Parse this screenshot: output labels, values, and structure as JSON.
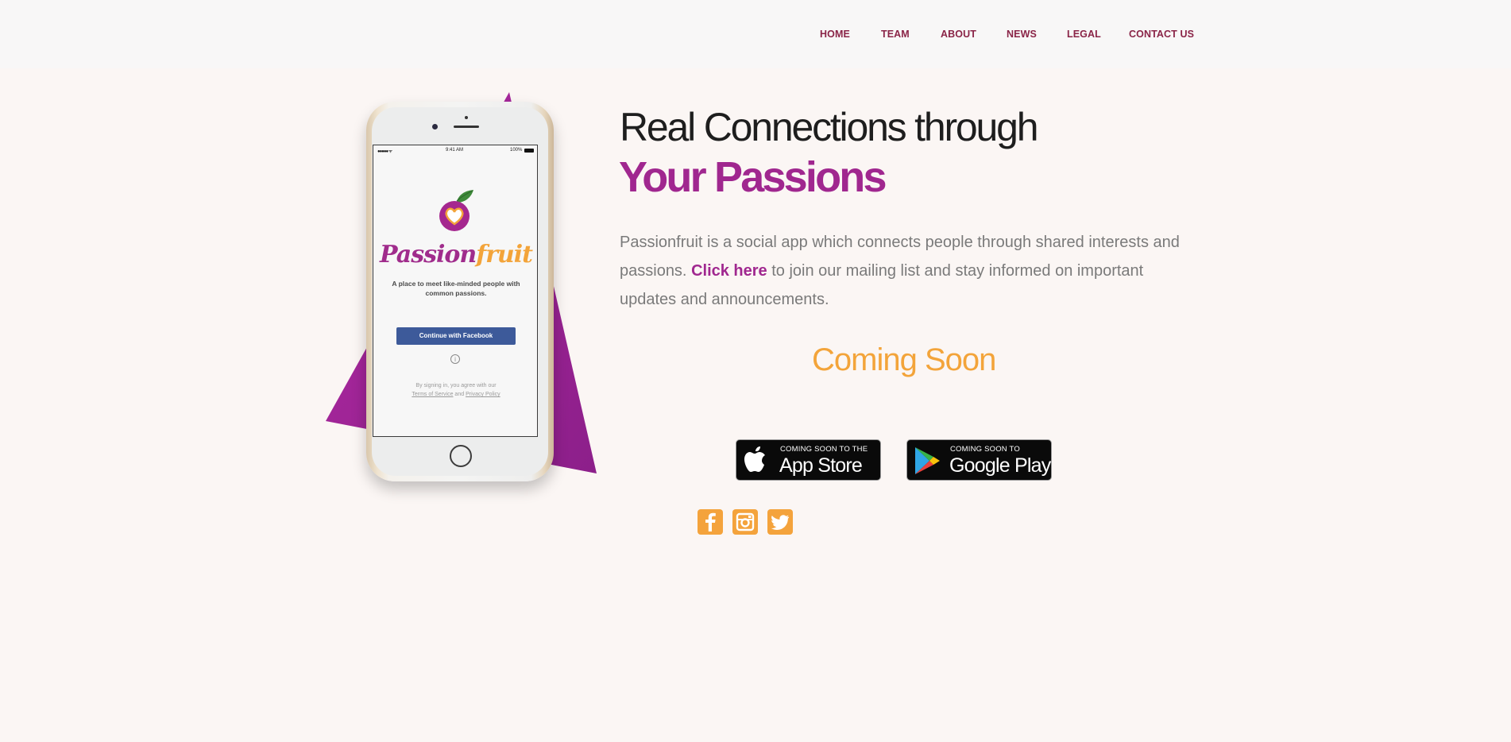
{
  "nav": {
    "items": [
      "HOME",
      "TEAM",
      "ABOUT",
      "NEWS",
      "LEGAL",
      "CONTACT US"
    ]
  },
  "phone": {
    "status_time": "9:41 AM",
    "status_battery": "100%",
    "wordmark_part1": "Passion",
    "wordmark_part2": "fruit",
    "tagline": "A place to meet like-minded people with common passions.",
    "facebook_button": "Continue with Facebook",
    "legal_prefix": "By signing in, you agree with our",
    "terms_link": "Terms of Service",
    "and_text": "and",
    "privacy_link": "Privacy Policy"
  },
  "hero": {
    "heading_line1": "Real Connections through",
    "heading_line2": "Your Passions",
    "intro_before": "Passionfruit is a social app which connects people through shared interests and passions. ",
    "intro_link": "Click here",
    "intro_after": " to join our mailing list and stay informed on important updates and announcements.",
    "coming_soon": "Coming Soon"
  },
  "stores": {
    "apple_small": "COMING SOON TO THE",
    "apple_large": "App Store",
    "google_small": "COMING SOON TO",
    "google_large": "Google Play"
  },
  "social": [
    "facebook-icon",
    "instagram-icon",
    "twitter-icon"
  ],
  "colors": {
    "nav": "#8a2447",
    "accent_purple": "#a0278f",
    "accent_orange": "#f3a43a",
    "background": "#fbf6f4",
    "header_bg": "#f8f7f7"
  }
}
